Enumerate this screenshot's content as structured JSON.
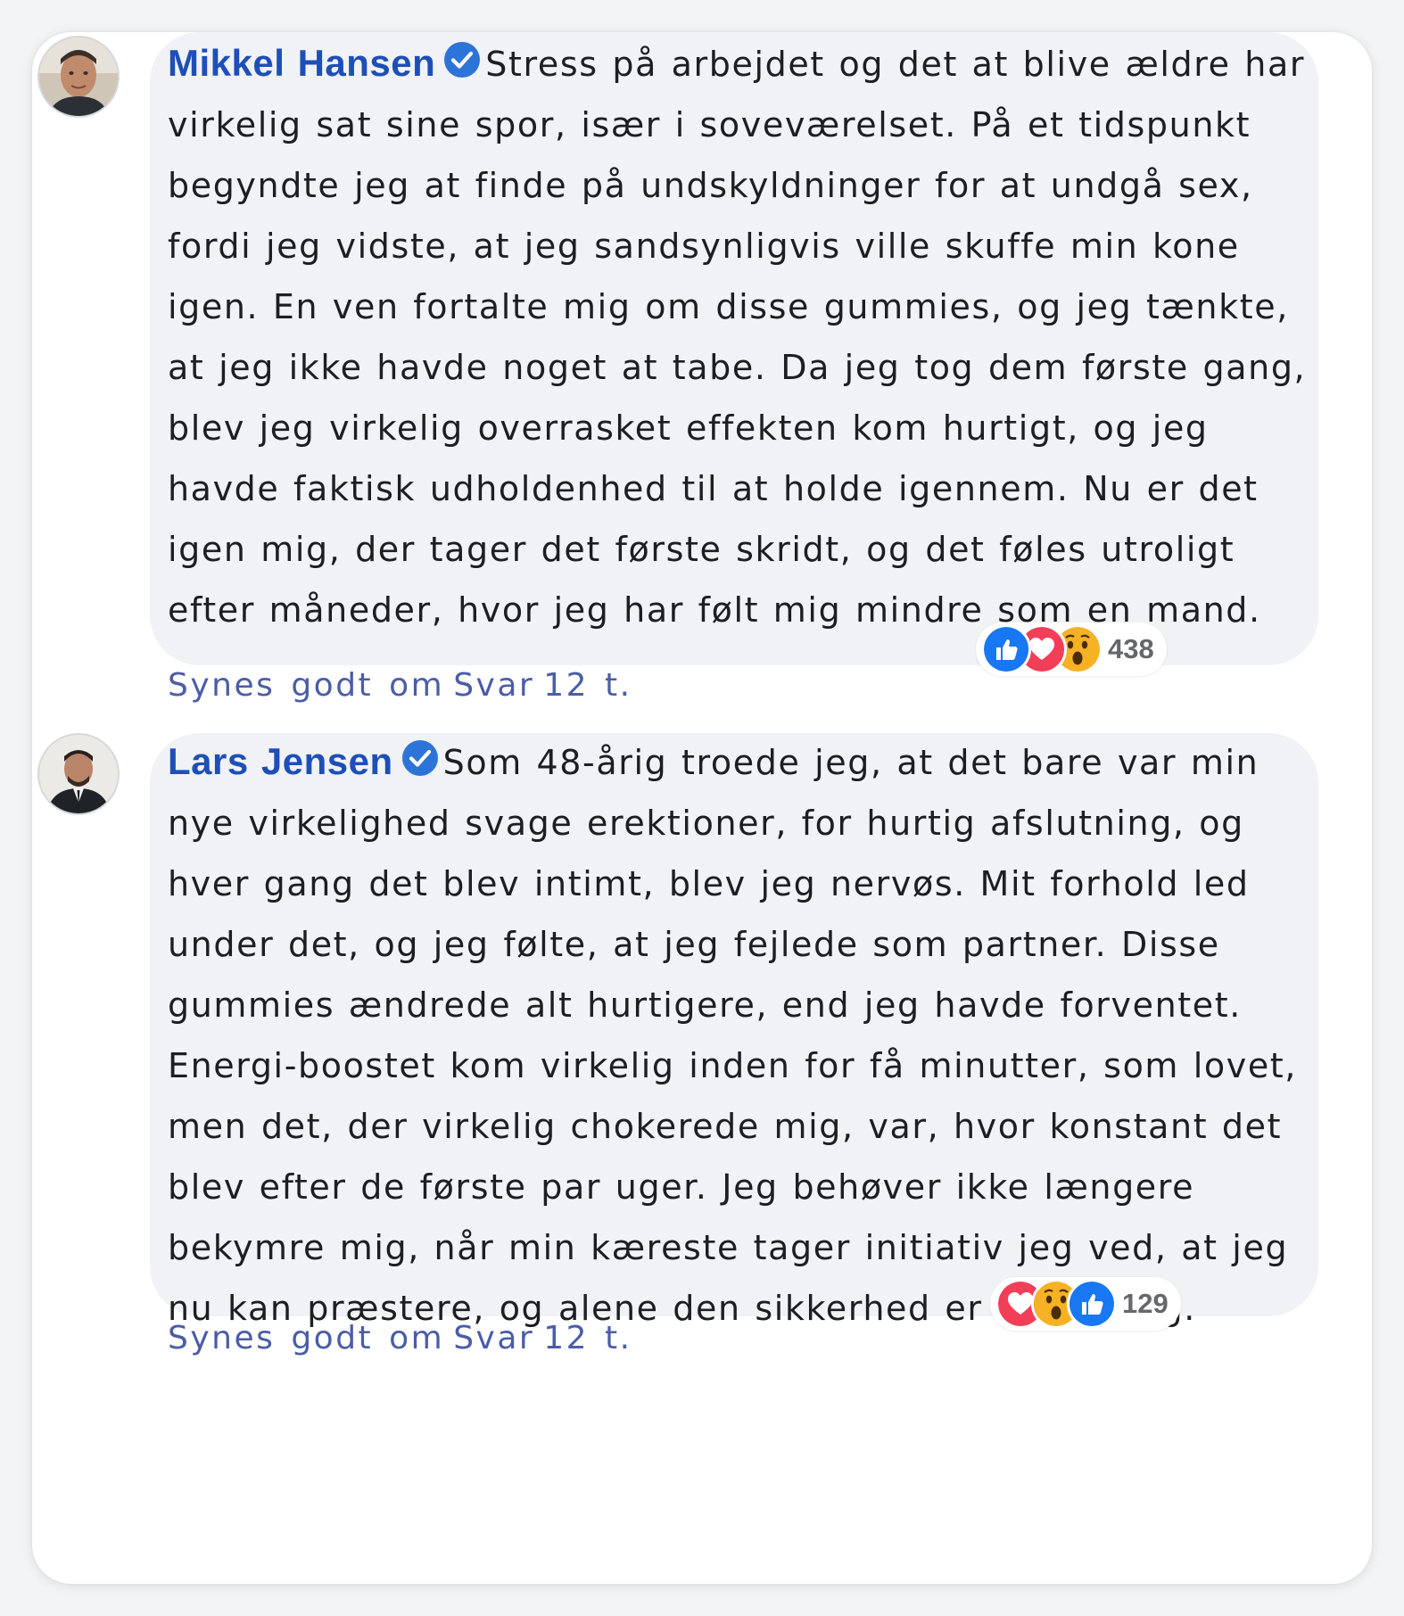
{
  "comments": [
    {
      "author": "Mikkel Hansen",
      "text": "Stress på arbejdet og det at blive ældre har virkelig sat sine spor, især i soveværelset. På et tidspunkt begyndte jeg at finde på undskyldninger for at undgå sex, fordi jeg vidste, at jeg sandsynligvis ville skuffe min kone igen. En ven fortalte mig om disse gummies, og jeg tænkte, at jeg ikke havde noget at tabe. Da jeg tog dem første gang, blev jeg virkelig overrasket effekten kom hurtigt, og jeg havde faktisk udholdenhed til at holde igennem. Nu er det igen mig, der tager det første skridt, og det føles utroligt efter måneder, hvor jeg har følt mig mindre som en mand.",
      "reaction_icons": [
        "like-icon",
        "love-icon",
        "wow-icon"
      ],
      "reaction_count": "438",
      "like_label": "Synes godt om",
      "reply_label": "Svar",
      "time": "12 t."
    },
    {
      "author": "Lars Jensen",
      "text": "Som 48-årig troede jeg, at det bare var min nye virkelighed svage erektioner, for hurtig afslutning, og hver gang det blev intimt, blev jeg nervøs. Mit forhold led under det, og jeg følte, at jeg fejlede som partner. Disse gummies ændrede alt hurtigere, end jeg havde forventet. Energi-boostet kom virkelig inden for få minutter, som lovet, men det, der virkelig chokerede mig, var, hvor konstant det blev efter de første par uger. Jeg behøver ikke længere bekymre mig, når min kæreste tager initiativ jeg ved, at jeg nu kan præstere, og alene den sikkerhed er uvurderlig.",
      "reaction_icons": [
        "love-icon",
        "wow-icon",
        "like-icon"
      ],
      "reaction_count": "129",
      "like_label": "Synes godt om",
      "reply_label": "Svar",
      "time": "12 t."
    }
  ],
  "colors": {
    "name": "#1e4fb8",
    "action": "#4b5da8",
    "bubble": "#f0f2f5",
    "like": "#1877f2",
    "love": "#f33e58",
    "wow": "#f7b125"
  }
}
